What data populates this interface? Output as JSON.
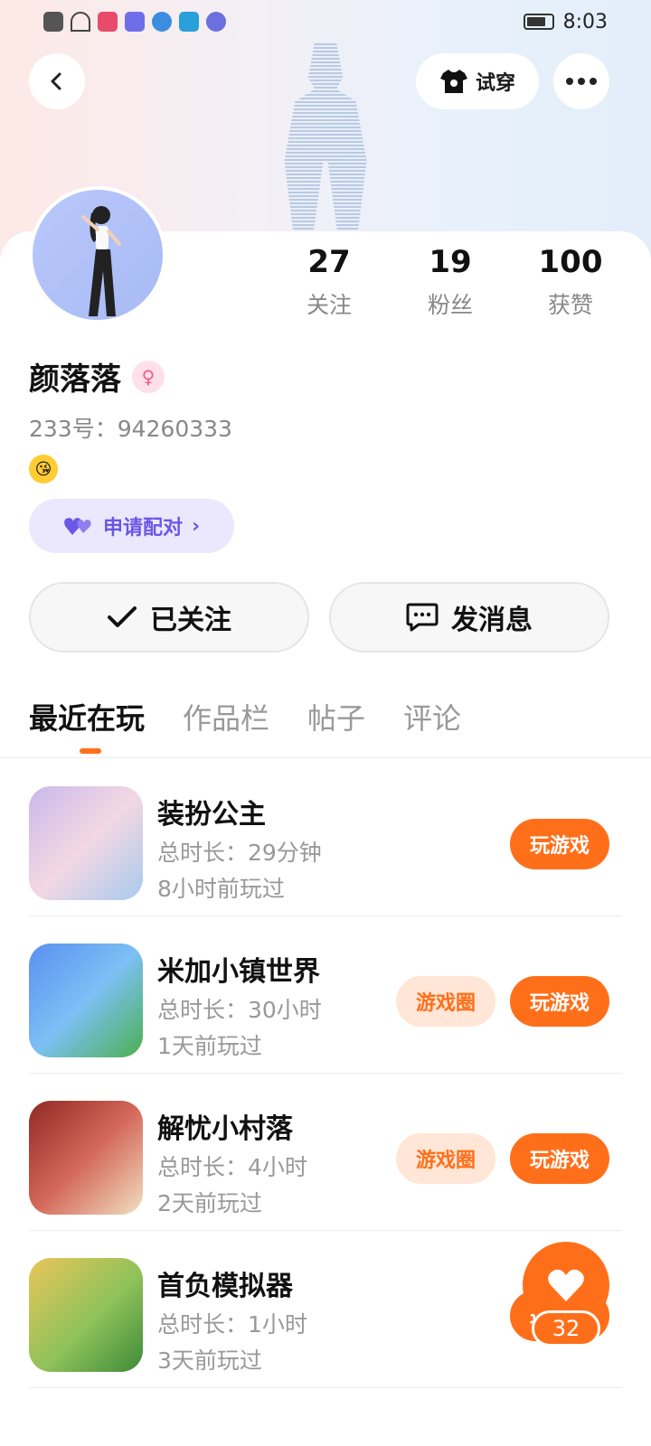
{
  "status_bar": {
    "time": "8:03"
  },
  "header": {
    "try_on_label": "试穿"
  },
  "profile": {
    "name": "颜落落",
    "uid_text": "233号：94260333",
    "pair_label": "申请配对",
    "stats": [
      {
        "value": "27",
        "label": "关注"
      },
      {
        "value": "19",
        "label": "粉丝"
      },
      {
        "value": "100",
        "label": "获赞"
      }
    ],
    "follow_label": "已关注",
    "message_label": "发消息"
  },
  "tabs": [
    {
      "label": "最近在玩",
      "active": true
    },
    {
      "label": "作品栏",
      "active": false
    },
    {
      "label": "帖子",
      "active": false
    },
    {
      "label": "评论",
      "active": false
    }
  ],
  "games": [
    {
      "title": "装扮公主",
      "duration": "总时长：29分钟",
      "last_played": "8小时前玩过",
      "has_circle": false,
      "play_label": "玩游戏",
      "icon_color": "#d9c3e6"
    },
    {
      "title": "米加小镇世界",
      "duration": "总时长：30小时",
      "last_played": "1天前玩过",
      "has_circle": true,
      "circle_label": "游戏圈",
      "play_label": "玩游戏",
      "icon_color": "#5a8ff0"
    },
    {
      "title": "解忧小村落",
      "duration": "总时长：4小时",
      "last_played": "2天前玩过",
      "has_circle": true,
      "circle_label": "游戏圈",
      "play_label": "玩游戏",
      "icon_color": "#b8453c"
    },
    {
      "title": "首负模拟器",
      "duration": "总时长：1小时",
      "last_played": "3天前玩过",
      "has_circle": false,
      "play_label": "玩游戏",
      "icon_color": "#d9a640"
    }
  ],
  "fab": {
    "count": "32"
  },
  "colors": {
    "accent": "#ff6f1a",
    "pair_accent": "#6b57e6"
  }
}
